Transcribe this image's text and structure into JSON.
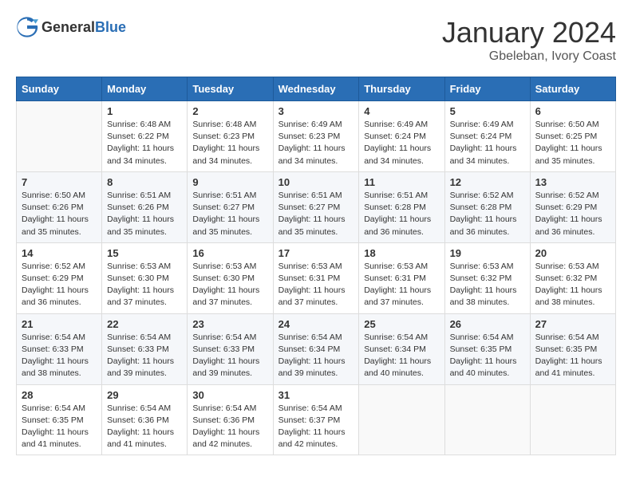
{
  "header": {
    "logo_general": "General",
    "logo_blue": "Blue",
    "month_title": "January 2024",
    "location": "Gbeleban, Ivory Coast"
  },
  "days_of_week": [
    "Sunday",
    "Monday",
    "Tuesday",
    "Wednesday",
    "Thursday",
    "Friday",
    "Saturday"
  ],
  "weeks": [
    [
      {
        "day": "",
        "info": ""
      },
      {
        "day": "1",
        "info": "Sunrise: 6:48 AM\nSunset: 6:22 PM\nDaylight: 11 hours and 34 minutes."
      },
      {
        "day": "2",
        "info": "Sunrise: 6:48 AM\nSunset: 6:23 PM\nDaylight: 11 hours and 34 minutes."
      },
      {
        "day": "3",
        "info": "Sunrise: 6:49 AM\nSunset: 6:23 PM\nDaylight: 11 hours and 34 minutes."
      },
      {
        "day": "4",
        "info": "Sunrise: 6:49 AM\nSunset: 6:24 PM\nDaylight: 11 hours and 34 minutes."
      },
      {
        "day": "5",
        "info": "Sunrise: 6:49 AM\nSunset: 6:24 PM\nDaylight: 11 hours and 34 minutes."
      },
      {
        "day": "6",
        "info": "Sunrise: 6:50 AM\nSunset: 6:25 PM\nDaylight: 11 hours and 35 minutes."
      }
    ],
    [
      {
        "day": "7",
        "info": "Sunrise: 6:50 AM\nSunset: 6:26 PM\nDaylight: 11 hours and 35 minutes."
      },
      {
        "day": "8",
        "info": "Sunrise: 6:51 AM\nSunset: 6:26 PM\nDaylight: 11 hours and 35 minutes."
      },
      {
        "day": "9",
        "info": "Sunrise: 6:51 AM\nSunset: 6:27 PM\nDaylight: 11 hours and 35 minutes."
      },
      {
        "day": "10",
        "info": "Sunrise: 6:51 AM\nSunset: 6:27 PM\nDaylight: 11 hours and 35 minutes."
      },
      {
        "day": "11",
        "info": "Sunrise: 6:51 AM\nSunset: 6:28 PM\nDaylight: 11 hours and 36 minutes."
      },
      {
        "day": "12",
        "info": "Sunrise: 6:52 AM\nSunset: 6:28 PM\nDaylight: 11 hours and 36 minutes."
      },
      {
        "day": "13",
        "info": "Sunrise: 6:52 AM\nSunset: 6:29 PM\nDaylight: 11 hours and 36 minutes."
      }
    ],
    [
      {
        "day": "14",
        "info": "Sunrise: 6:52 AM\nSunset: 6:29 PM\nDaylight: 11 hours and 36 minutes."
      },
      {
        "day": "15",
        "info": "Sunrise: 6:53 AM\nSunset: 6:30 PM\nDaylight: 11 hours and 37 minutes."
      },
      {
        "day": "16",
        "info": "Sunrise: 6:53 AM\nSunset: 6:30 PM\nDaylight: 11 hours and 37 minutes."
      },
      {
        "day": "17",
        "info": "Sunrise: 6:53 AM\nSunset: 6:31 PM\nDaylight: 11 hours and 37 minutes."
      },
      {
        "day": "18",
        "info": "Sunrise: 6:53 AM\nSunset: 6:31 PM\nDaylight: 11 hours and 37 minutes."
      },
      {
        "day": "19",
        "info": "Sunrise: 6:53 AM\nSunset: 6:32 PM\nDaylight: 11 hours and 38 minutes."
      },
      {
        "day": "20",
        "info": "Sunrise: 6:53 AM\nSunset: 6:32 PM\nDaylight: 11 hours and 38 minutes."
      }
    ],
    [
      {
        "day": "21",
        "info": "Sunrise: 6:54 AM\nSunset: 6:33 PM\nDaylight: 11 hours and 38 minutes."
      },
      {
        "day": "22",
        "info": "Sunrise: 6:54 AM\nSunset: 6:33 PM\nDaylight: 11 hours and 39 minutes."
      },
      {
        "day": "23",
        "info": "Sunrise: 6:54 AM\nSunset: 6:33 PM\nDaylight: 11 hours and 39 minutes."
      },
      {
        "day": "24",
        "info": "Sunrise: 6:54 AM\nSunset: 6:34 PM\nDaylight: 11 hours and 39 minutes."
      },
      {
        "day": "25",
        "info": "Sunrise: 6:54 AM\nSunset: 6:34 PM\nDaylight: 11 hours and 40 minutes."
      },
      {
        "day": "26",
        "info": "Sunrise: 6:54 AM\nSunset: 6:35 PM\nDaylight: 11 hours and 40 minutes."
      },
      {
        "day": "27",
        "info": "Sunrise: 6:54 AM\nSunset: 6:35 PM\nDaylight: 11 hours and 41 minutes."
      }
    ],
    [
      {
        "day": "28",
        "info": "Sunrise: 6:54 AM\nSunset: 6:35 PM\nDaylight: 11 hours and 41 minutes."
      },
      {
        "day": "29",
        "info": "Sunrise: 6:54 AM\nSunset: 6:36 PM\nDaylight: 11 hours and 41 minutes."
      },
      {
        "day": "30",
        "info": "Sunrise: 6:54 AM\nSunset: 6:36 PM\nDaylight: 11 hours and 42 minutes."
      },
      {
        "day": "31",
        "info": "Sunrise: 6:54 AM\nSunset: 6:37 PM\nDaylight: 11 hours and 42 minutes."
      },
      {
        "day": "",
        "info": ""
      },
      {
        "day": "",
        "info": ""
      },
      {
        "day": "",
        "info": ""
      }
    ]
  ]
}
